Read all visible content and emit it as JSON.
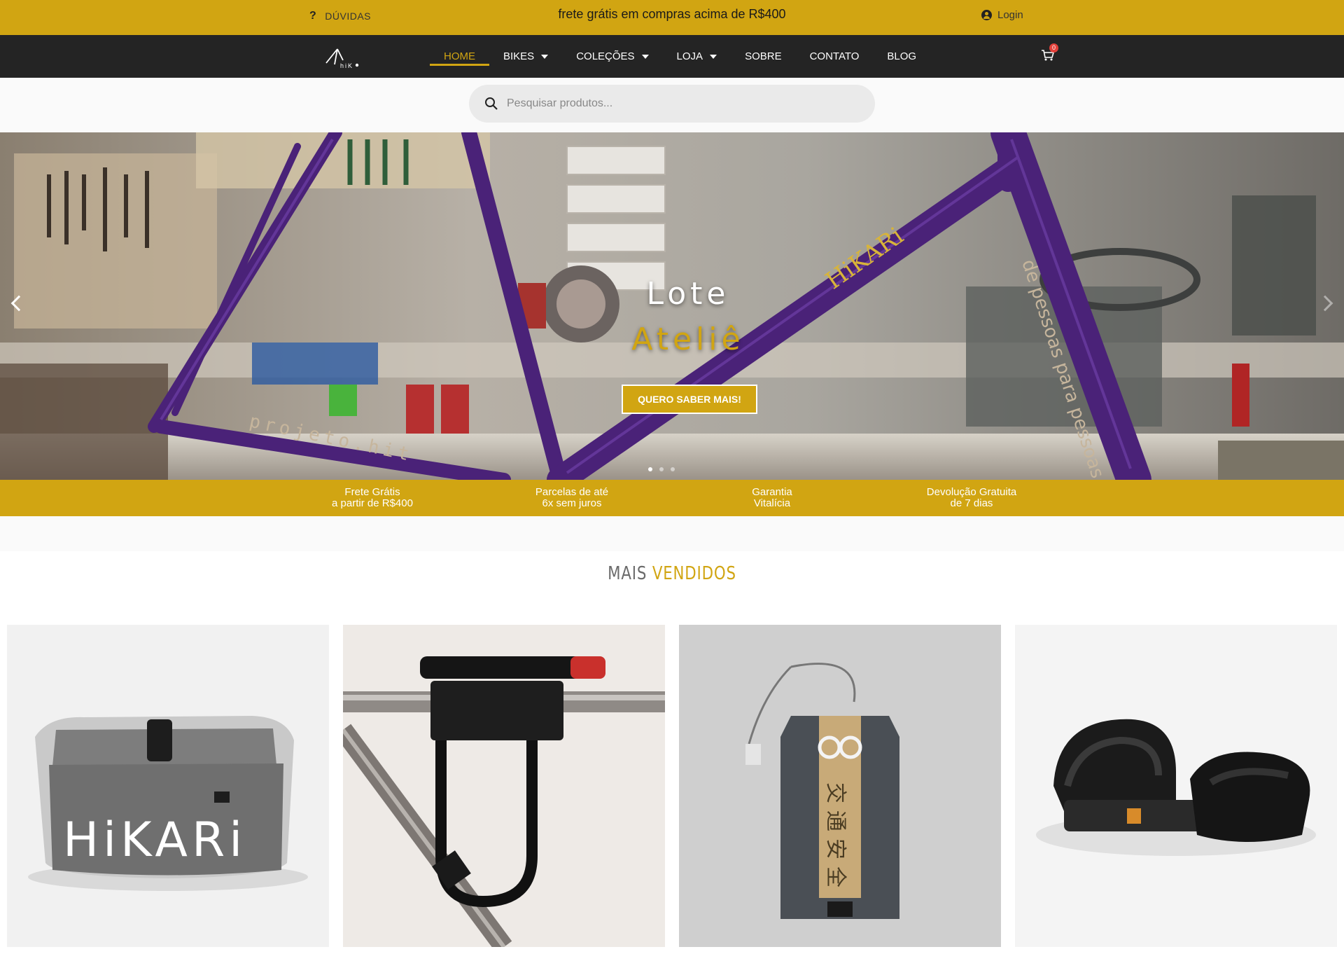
{
  "topbar": {
    "help_icon": "question-icon",
    "help_label": "DÚVIDAS",
    "promo": "frete grátis em compras acima de R$400",
    "login_icon": "user-circle-icon",
    "login_label": "Login"
  },
  "nav": {
    "logo": "hiK",
    "items": [
      {
        "label": "HOME",
        "active": true
      },
      {
        "label": "BIKES",
        "dropdown": true
      },
      {
        "label": "COLEÇÕES",
        "dropdown": true
      },
      {
        "label": "LOJA",
        "dropdown": true
      },
      {
        "label": "SOBRE"
      },
      {
        "label": "CONTATO"
      },
      {
        "label": "BLOG"
      }
    ],
    "cart_icon": "cart-icon",
    "cart_count": "0"
  },
  "search": {
    "icon": "search-icon",
    "placeholder": "Pesquisar produtos..."
  },
  "hero": {
    "title_line1": "Lote",
    "title_line2": "Ateliê",
    "cta_label": "QUERO SABER MAIS!",
    "frame_text_top": "HiKARi",
    "frame_text_side": "de pessoas para pessoas",
    "frame_text_bottom": "projeto.hit",
    "slide_dots": 3,
    "active_dot": 0
  },
  "benefits": [
    {
      "line1": "Frete Grátis",
      "line2": "a partir de R$400"
    },
    {
      "line1": "Parcelas de até",
      "line2": "6x sem juros"
    },
    {
      "line1": "Garantia",
      "line2": "Vitalícia"
    },
    {
      "line1": "Devolução Gratuita",
      "line2": "de 7 dias"
    }
  ],
  "best_sellers": {
    "title_part1": "MAIS",
    "title_part2": "VENDIDOS",
    "products": [
      {
        "image": "handlebar-bag",
        "print": "HiKARi"
      },
      {
        "image": "u-lock-holder"
      },
      {
        "image": "omamori-tag",
        "print": "交通安全"
      },
      {
        "image": "pedal-straps"
      }
    ]
  },
  "colors": {
    "accent": "#d1a512",
    "nav_bg": "#242424",
    "badge": "#e3403a"
  }
}
